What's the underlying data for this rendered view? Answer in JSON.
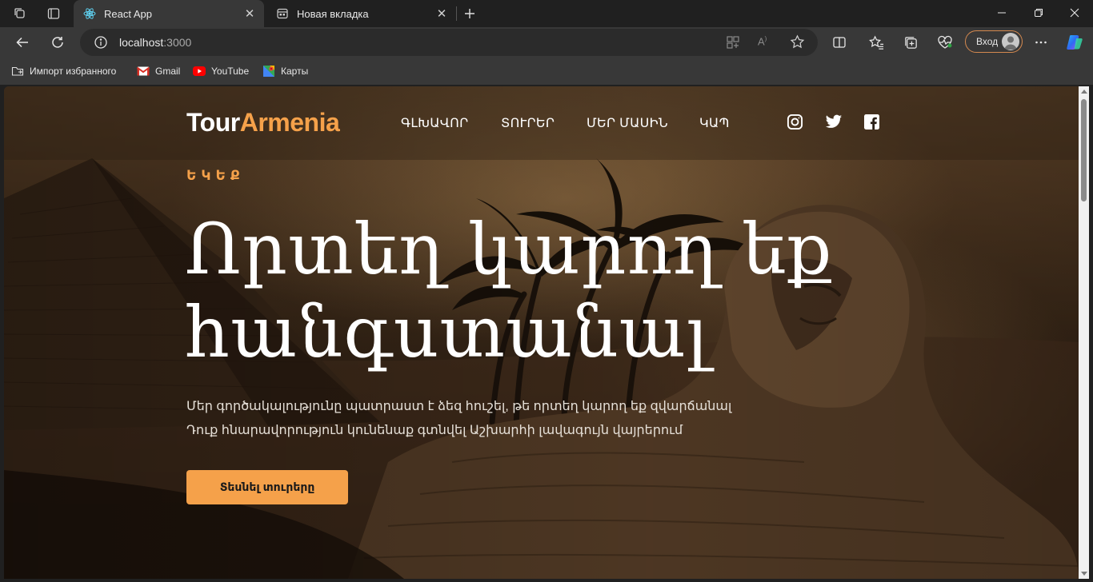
{
  "browser": {
    "tabs": [
      {
        "title": "React App",
        "active": true
      },
      {
        "title": "Новая вкладка",
        "active": false
      }
    ],
    "address": {
      "host": "localhost",
      "port": ":3000"
    },
    "signin_label": "Вход",
    "bookmarks": [
      {
        "label": "Импорт избранного",
        "icon": "folder-import-icon"
      },
      {
        "label": "Gmail",
        "icon": "gmail-icon"
      },
      {
        "label": "YouTube",
        "icon": "youtube-icon"
      },
      {
        "label": "Карты",
        "icon": "maps-icon"
      }
    ]
  },
  "site": {
    "logo": {
      "part1": "Tour",
      "part2": "Armenia"
    },
    "nav": [
      "ԳԼԽԱՎՈՐ",
      "ՏՈՒՐԵՐ",
      "ՄԵՐ ՄԱՍԻՆ",
      "ԿԱՊ"
    ],
    "social": [
      "instagram-icon",
      "twitter-icon",
      "facebook-icon"
    ],
    "hero": {
      "eyebrow": "ԵԿԵՔ",
      "title_line1": "Որտեղ կարող եք",
      "title_line2": "հանգստանալ",
      "subtitle_line1": "Մեր գործակալությունը պատրաստ է ձեզ հուշել, թե որտեղ կարող եք զվարճանալ",
      "subtitle_line2": "Դուք հնարավորություն կունենաք գտնվել Աշխարհի լավագույն վայրերում",
      "cta": "Տեսնել տուրերը"
    }
  },
  "colors": {
    "accent": "#f5a14a",
    "chrome": "#383838",
    "tabstrip": "#202020"
  }
}
